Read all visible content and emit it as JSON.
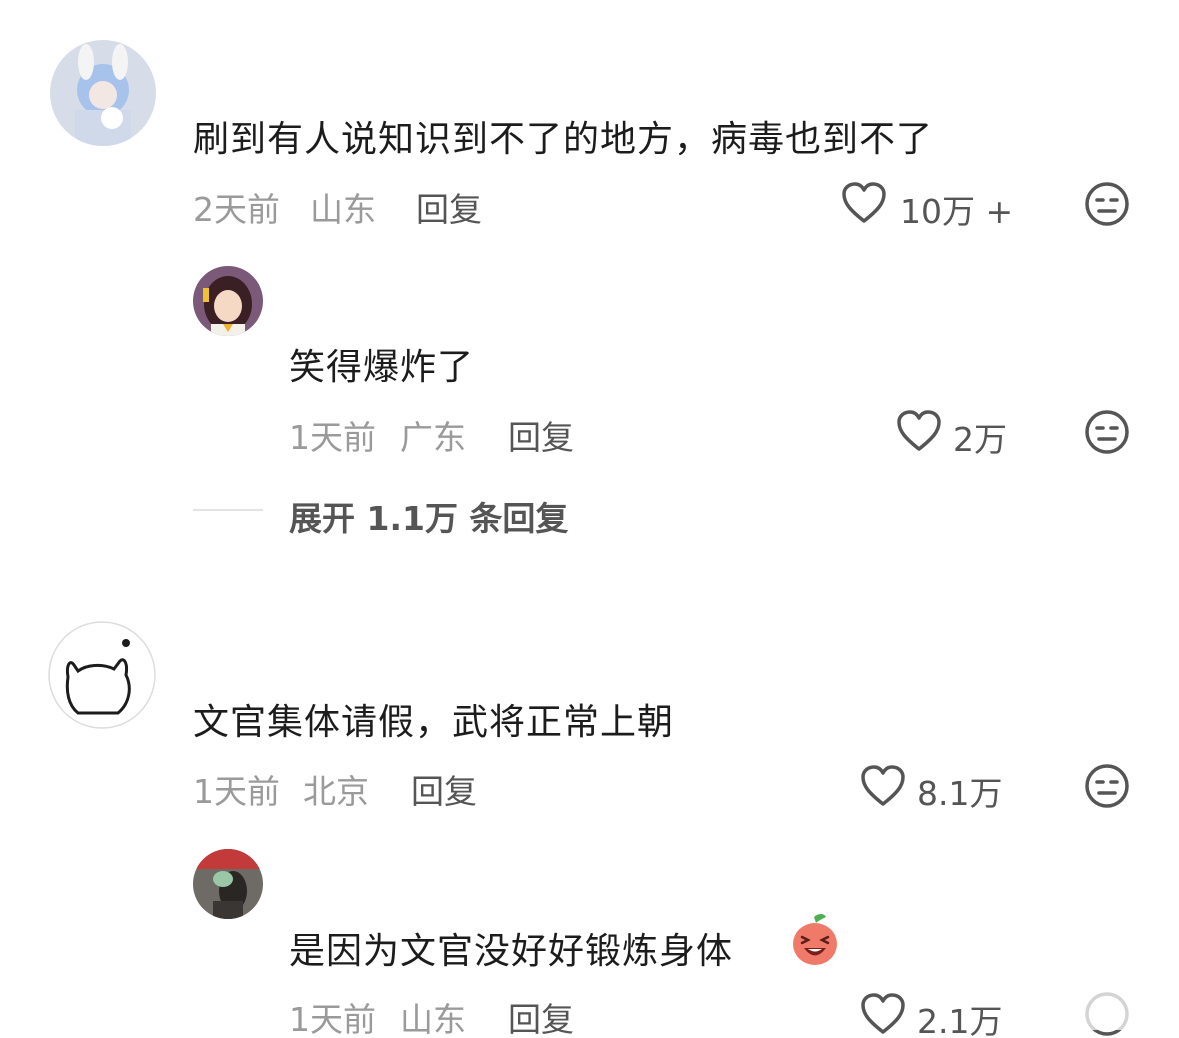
{
  "comments": [
    {
      "text": "刷到有人说知识到不了的地方，病毒也到不了",
      "time": "2天前",
      "location": "山东",
      "reply_label": "回复",
      "likes": "10万 +"
    },
    {
      "text": "笑得爆炸了",
      "time": "1天前",
      "location": "广东",
      "reply_label": "回复",
      "likes": "2万"
    },
    {
      "text": "文官集体请假，武将正常上朝",
      "time": "1天前",
      "location": "北京",
      "reply_label": "回复",
      "likes": "8.1万"
    },
    {
      "text": "是因为文官没好好锻炼身体",
      "time": "1天前",
      "location": "山东",
      "reply_label": "回复",
      "likes": "2.1万"
    }
  ],
  "expand_replies": "展开 1.1万 条回复",
  "icons": {
    "like": "heart-outline-icon",
    "dislike": "meh-face-icon",
    "emoji": "laughing-peach-emoji"
  },
  "colors": {
    "meta": "#9a9a9a",
    "action": "#555555",
    "text": "#1c1c1c"
  }
}
